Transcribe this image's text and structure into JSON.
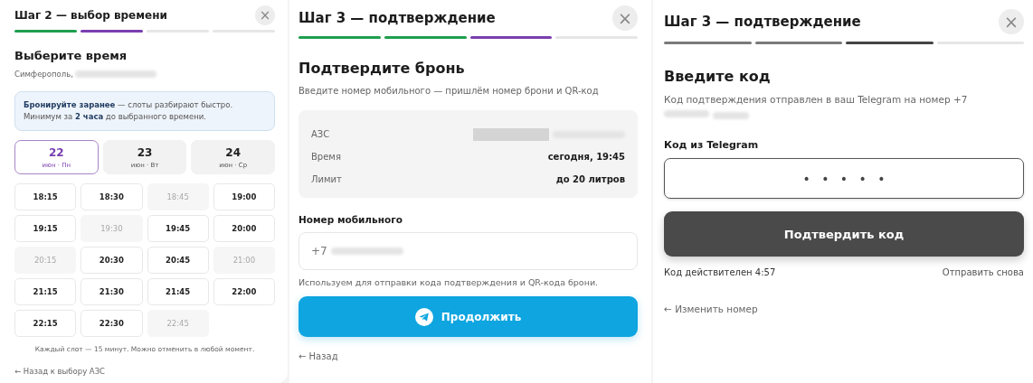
{
  "panels": [
    {
      "title": "Шаг 2 — выбор времени",
      "close": "×",
      "steps": [
        {
          "color": "#1f9e4f"
        },
        {
          "color": "#7b3fb0"
        },
        {
          "color": "#e6e6e6"
        },
        {
          "color": "#e6e6e6"
        }
      ],
      "heading": "Выберите время",
      "subtitle": "Симферополь,",
      "subtitle_redacted": true,
      "notice": "**Бронируйте заранее** — слоты разбирают быстро. Минимум за **2 часа** до выбранного времени.",
      "days": [
        {
          "day": "22",
          "label": "июн · Пн",
          "selected": true
        },
        {
          "day": "23",
          "label": "июн · Вт",
          "selected": false
        },
        {
          "day": "24",
          "label": "июн · Ср",
          "selected": false
        }
      ],
      "slots": [
        {
          "time": "18:15",
          "disabled": false
        },
        {
          "time": "18:30",
          "disabled": false
        },
        {
          "time": "18:45",
          "disabled": true
        },
        {
          "time": "19:00",
          "disabled": false
        },
        {
          "time": "19:15",
          "disabled": false
        },
        {
          "time": "19:30",
          "disabled": true
        },
        {
          "time": "19:45",
          "disabled": false
        },
        {
          "time": "20:00",
          "disabled": false
        },
        {
          "time": "20:15",
          "disabled": true
        },
        {
          "time": "20:30",
          "disabled": false
        },
        {
          "time": "20:45",
          "disabled": false
        },
        {
          "time": "21:00",
          "disabled": true
        },
        {
          "time": "21:15",
          "disabled": false
        },
        {
          "time": "21:30",
          "disabled": false
        },
        {
          "time": "21:45",
          "disabled": false
        },
        {
          "time": "22:00",
          "disabled": false
        },
        {
          "time": "22:15",
          "disabled": false
        },
        {
          "time": "22:30",
          "disabled": false
        },
        {
          "time": "22:45",
          "disabled": true
        }
      ],
      "footnote": "Каждый слот — 15 минут. Можно отменить в любой момент.",
      "back_link": "← Назад к выбору АЗС"
    },
    {
      "title": "Шаг 3 — подтверждение",
      "close": "×",
      "steps": [
        {
          "color": "#1f9e4f"
        },
        {
          "color": "#1f9e4f"
        },
        {
          "color": "#7b3fb0"
        },
        {
          "color": "#e6e6e6"
        }
      ],
      "heading": "Подтвердите бронь",
      "subtitle": "Введите номер мобильного — пришлём номер брони и QR-код",
      "summary": [
        {
          "label": "АЗС",
          "redacted": true
        },
        {
          "label": "Время",
          "value": "сегодня, 19:45"
        },
        {
          "label": "Лимит",
          "value": "до 20 литров"
        }
      ],
      "field": {
        "label": "Номер мобильного",
        "value": "+7",
        "redacted": true
      },
      "hint": "Используем для отправки кода подтверждения и QR-кода брони.",
      "button": {
        "label": "Продолжить",
        "kind": "telegram"
      },
      "back_link": "← Назад"
    },
    {
      "title": "Шаг 3 — подтверждение",
      "close": "×",
      "steps": [
        {
          "color": "#7a7a7a"
        },
        {
          "color": "#7a7a7a"
        },
        {
          "color": "#444444"
        },
        {
          "color": "#e6e6e6"
        }
      ],
      "heading": "Введите код",
      "subtitle": "Код подтверждения отправлен в ваш Telegram на номер +7",
      "subtitle_redacted": true,
      "field": {
        "label": "Код из Telegram",
        "value": "• • • • •"
      },
      "button": {
        "label": "Подтвердить код",
        "kind": "dark"
      },
      "timer": "Код действителен 4:57",
      "resend": "Отправить снова",
      "back_link": "← Изменить номер"
    }
  ]
}
